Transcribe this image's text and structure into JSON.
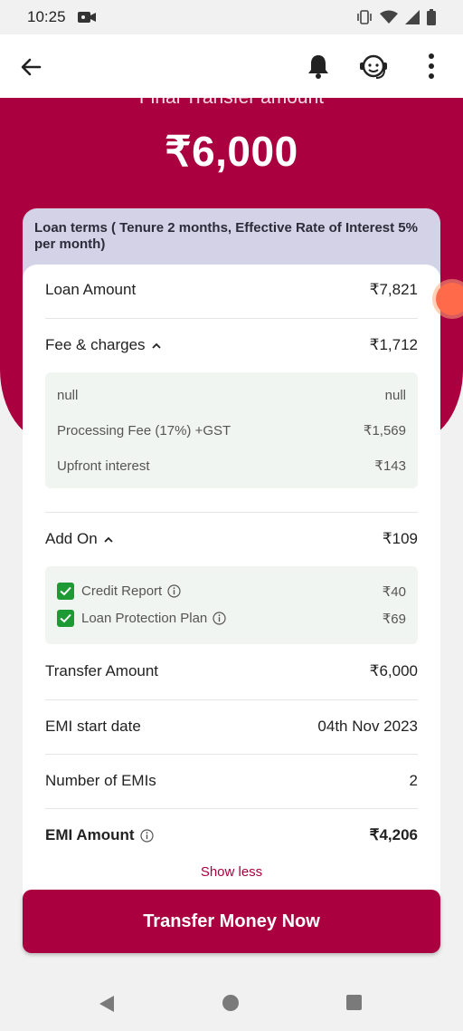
{
  "status": {
    "time": "10:25"
  },
  "hero": {
    "label": "Final Transfer amount",
    "amount": "₹6,000"
  },
  "loan_terms": "Loan terms ( Tenure 2 months, Effective Rate of Interest 5% per month)",
  "rows": {
    "loan_amount": {
      "label": "Loan Amount",
      "value": "₹7,821"
    },
    "fees": {
      "label": "Fee & charges",
      "value": "₹1,712"
    },
    "addon": {
      "label": "Add On",
      "value": "₹109"
    },
    "transfer": {
      "label": "Transfer Amount",
      "value": "₹6,000"
    },
    "emi_start": {
      "label": "EMI start date",
      "value": "04th Nov 2023"
    },
    "num_emis": {
      "label": "Number of EMIs",
      "value": "2"
    },
    "emi_amount": {
      "label": "EMI Amount",
      "value": "₹4,206"
    }
  },
  "fee_items": [
    {
      "label": "null",
      "value": "null"
    },
    {
      "label": "Processing Fee (17%) +GST",
      "value": "₹1,569"
    },
    {
      "label": "Upfront interest",
      "value": "₹143"
    }
  ],
  "addon_items": [
    {
      "label": "Credit Report",
      "value": "₹40"
    },
    {
      "label": "Loan Protection Plan",
      "value": "₹69"
    }
  ],
  "show_less": "Show less",
  "cta": "Transfer Money Now",
  "icons": {
    "back": "arrow-left-icon",
    "bell": "bell-icon",
    "support": "support-agent-icon",
    "more": "more-vertical-icon"
  },
  "colors": {
    "brand": "#ab0040",
    "check": "#1e9a34",
    "terms_bg": "#d3d2e6"
  }
}
